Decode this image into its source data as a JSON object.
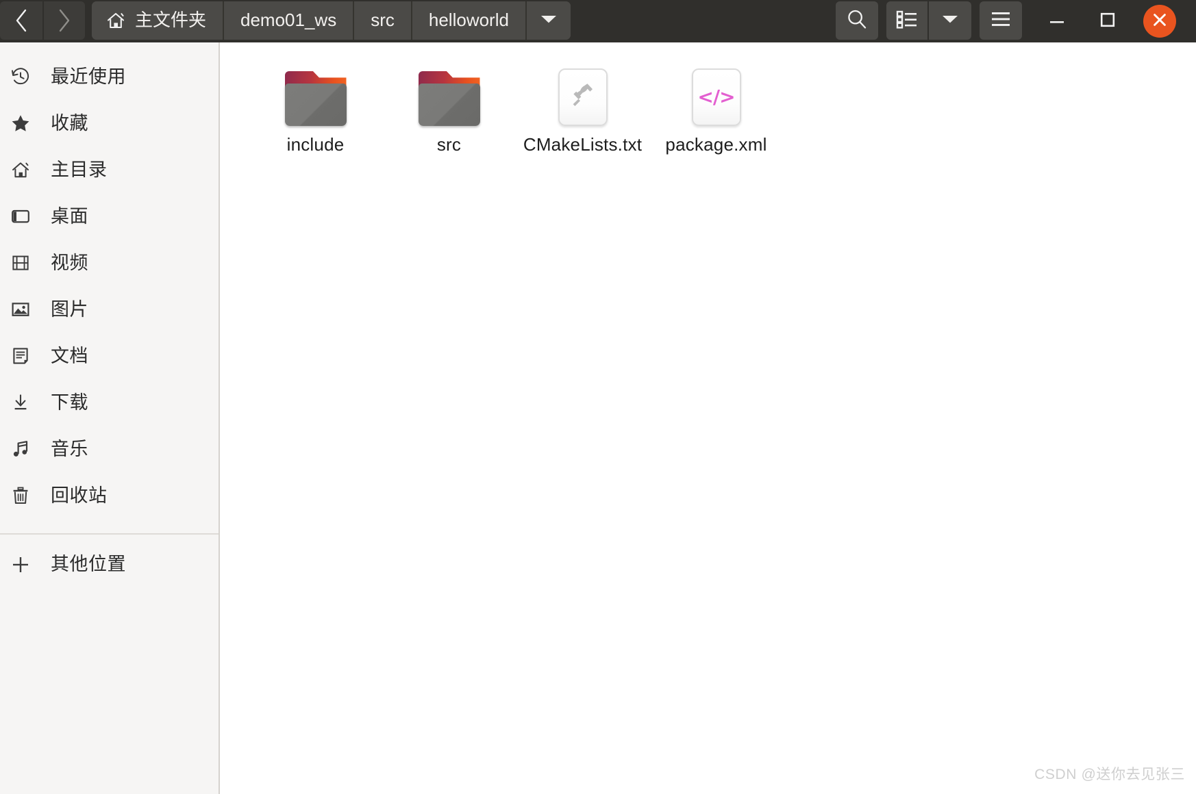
{
  "window": {
    "titlebar_bg": "#302f2c",
    "accent_close": "#e9541f",
    "sidebar_bg": "#f6f5f4",
    "content_bg": "#ffffff"
  },
  "header": {
    "nav": {
      "back_label": "‹",
      "forward_label": "›",
      "back_name": "back-button",
      "forward_name": "forward-button"
    },
    "breadcrumbs": [
      {
        "label": "主文件夹",
        "icon": "home-icon",
        "active": false
      },
      {
        "label": "demo01_ws",
        "icon": "",
        "active": false
      },
      {
        "label": "src",
        "icon": "",
        "active": false
      },
      {
        "label": "helloworld",
        "icon": "",
        "active": true
      }
    ],
    "breadcrumb_dropdown_icon": "chevron-down-icon",
    "tools": [
      {
        "name": "search-button",
        "icon": "search-icon"
      },
      {
        "name": "view-list-button",
        "icon": "list-view-icon"
      },
      {
        "name": "view-options-button",
        "icon": "chevron-down-icon"
      },
      {
        "name": "menu-button",
        "icon": "hamburger-menu-icon"
      }
    ],
    "window_controls": [
      {
        "name": "minimize-button",
        "icon": "minimize-icon"
      },
      {
        "name": "maximize-button",
        "icon": "maximize-icon"
      },
      {
        "name": "close-button",
        "icon": "close-icon"
      }
    ]
  },
  "sidebar": {
    "items": [
      {
        "label": "最近使用",
        "icon": "recent-clock-icon",
        "name": "sidebar-item-recent"
      },
      {
        "label": "收藏",
        "icon": "star-icon",
        "name": "sidebar-item-starred"
      },
      {
        "label": "主目录",
        "icon": "home-icon",
        "name": "sidebar-item-home"
      },
      {
        "label": "桌面",
        "icon": "desktop-icon",
        "name": "sidebar-item-desktop"
      },
      {
        "label": "视频",
        "icon": "video-film-icon",
        "name": "sidebar-item-videos"
      },
      {
        "label": "图片",
        "icon": "image-picture-icon",
        "name": "sidebar-item-pictures"
      },
      {
        "label": "文档",
        "icon": "document-icon",
        "name": "sidebar-item-documents"
      },
      {
        "label": "下载",
        "icon": "download-arrow-icon",
        "name": "sidebar-item-downloads"
      },
      {
        "label": "音乐",
        "icon": "music-note-icon",
        "name": "sidebar-item-music"
      },
      {
        "label": "回收站",
        "icon": "trash-icon",
        "name": "sidebar-item-trash"
      }
    ],
    "other_locations": {
      "label": "其他位置",
      "icon": "plus-icon",
      "name": "sidebar-item-other-locations"
    }
  },
  "main": {
    "files": [
      {
        "name": "include",
        "type": "folder",
        "icon": "folder-icon"
      },
      {
        "name": "src",
        "type": "folder",
        "icon": "folder-icon"
      },
      {
        "name": "CMakeLists.txt",
        "type": "file",
        "icon": "hammer-build-file-icon"
      },
      {
        "name": "package.xml",
        "type": "file",
        "icon": "xml-code-file-icon"
      }
    ]
  },
  "watermark": {
    "text": "CSDN @送你去见张三"
  }
}
